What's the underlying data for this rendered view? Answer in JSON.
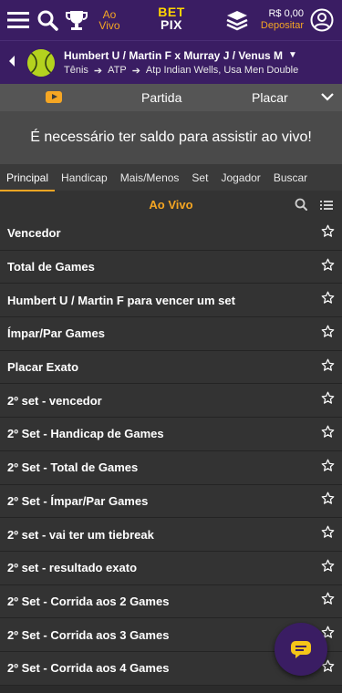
{
  "topbar": {
    "ao_vivo": "Ao Vivo",
    "logo_top": "BET",
    "logo_bottom": "PIX",
    "balance": "R$ 0,00",
    "deposit": "Depositar"
  },
  "match": {
    "title": "Humbert U / Martin F x Murray J / Venus M",
    "crumbs": [
      "Tênis",
      "ATP",
      "Atp Indian Wells, Usa Men Double"
    ]
  },
  "stream": {
    "tab_partida": "Partida",
    "tab_placar": "Placar"
  },
  "notice": "É necessário ter saldo para assistir ao vivo!",
  "tabs": [
    "Principal",
    "Handicap",
    "Mais/Menos",
    "Set",
    "Jogador",
    "Buscar"
  ],
  "live_title": "Ao Vivo",
  "markets": [
    "Vencedor",
    "Total de Games",
    "Humbert U / Martin F para vencer um set",
    "Ímpar/Par Games",
    "Placar Exato",
    "2º set - vencedor",
    "2º Set - Handicap de Games",
    "2º Set - Total de Games",
    "2º Set - Ímpar/Par Games",
    "2º set - vai ter um tiebreak",
    "2º set - resultado exato",
    "2º Set - Corrida aos 2 Games",
    "2º Set - Corrida aos 3 Games",
    "2º Set - Corrida aos 4 Games"
  ],
  "colors": {
    "header_purple": "#3a1d63",
    "accent_orange": "#f5a623",
    "row_bg": "#333333"
  },
  "icons": [
    "menu-icon",
    "search-icon",
    "trophy-icon",
    "layers-icon",
    "user-icon",
    "star-icon",
    "chat-icon"
  ]
}
